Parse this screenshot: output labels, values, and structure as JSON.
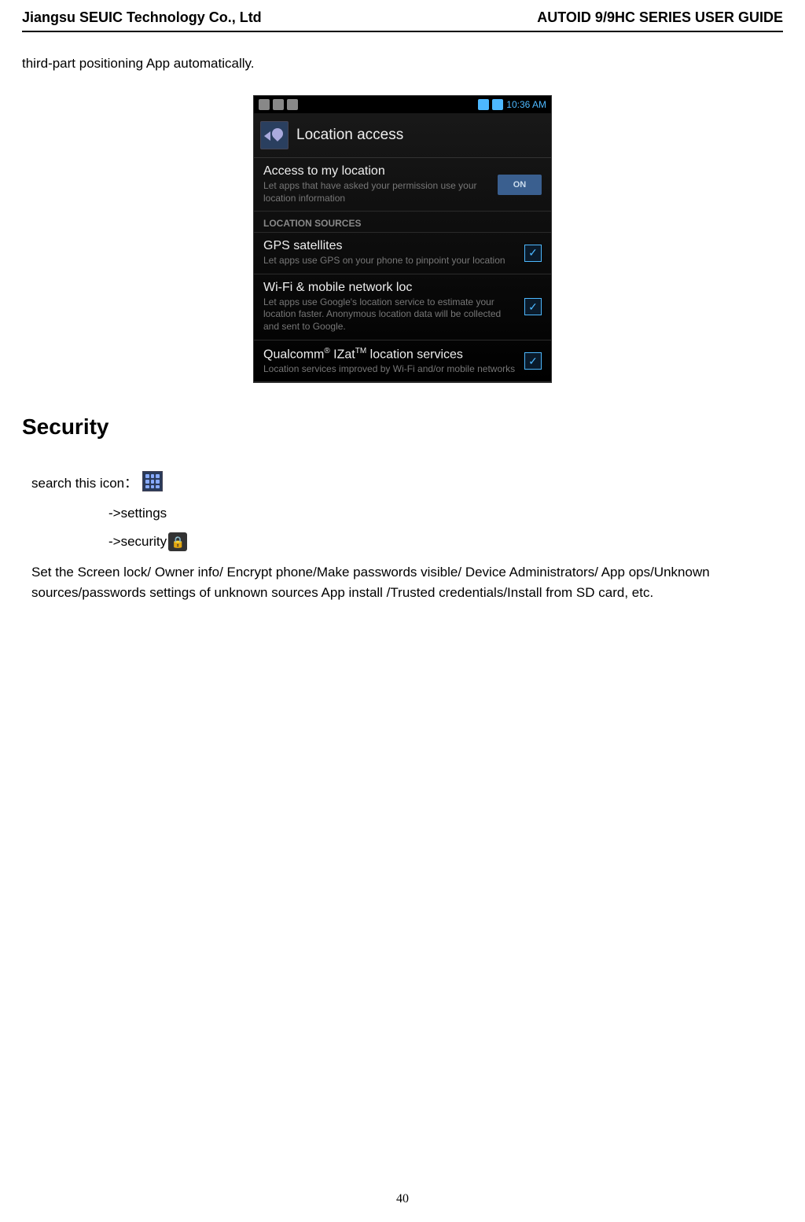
{
  "header": {
    "left": "Jiangsu SEUIC Technology Co., Ltd",
    "right": "AUTOID 9/9HC SERIES USER GUIDE"
  },
  "intro": "third-part positioning App automatically.",
  "screenshot": {
    "status_time": "10:36 AM",
    "title": "Location access",
    "access": {
      "title": "Access to my location",
      "desc": "Let apps that have asked your permission use your location information",
      "toggle": "ON"
    },
    "section_label": "LOCATION SOURCES",
    "gps": {
      "title": "GPS satellites",
      "desc": "Let apps use GPS on your phone to pinpoint your location"
    },
    "wifi": {
      "title": "Wi-Fi & mobile network loc",
      "desc": "Let apps use Google's location service to estimate your location faster. Anonymous location data will be collected and sent to Google."
    },
    "qualcomm": {
      "title_prefix": "Qualcomm",
      "title_sup1": "®",
      "title_mid": " IZat",
      "title_sup2": "TM",
      "title_suffix": " location services",
      "desc": "Location services improved by Wi-Fi and/or mobile networks"
    }
  },
  "security": {
    "heading": "Security",
    "search_label": "search this icon：",
    "settings_line": "->settings",
    "security_line": "->security",
    "body": "Set the Screen lock/ Owner info/ Encrypt phone/Make passwords visible/ Device Administrators/ App ops/Unknown sources/passwords settings of unknown sources App install /Trusted credentials/Install from SD card, etc."
  },
  "page_number": "40"
}
